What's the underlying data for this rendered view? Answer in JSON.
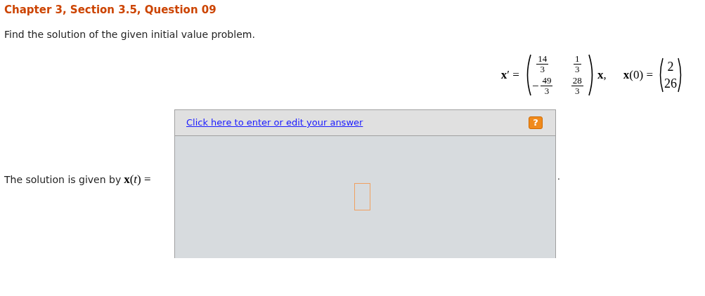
{
  "title": "Chapter 3, Section 3.5, Question 09",
  "prompt": "Find the solution of the given initial value problem.",
  "equation": {
    "lhs": "**x**′ =",
    "matrix": [
      [
        {
          "num": "14",
          "den": "3"
        },
        {
          "num": "1",
          "den": "3"
        }
      ],
      [
        {
          "sign": "−",
          "num": "49",
          "den": "3"
        },
        {
          "num": "28",
          "den": "3"
        }
      ]
    ],
    "rhs": "**x**,",
    "init": "**x**(0) =",
    "vector": [
      "2",
      "26"
    ]
  },
  "answer": {
    "label": "The solution is given by",
    "math": "**x**(*t*) =",
    "link": "Click here to enter or edit your answer",
    "help": "?",
    "trailing": "."
  }
}
